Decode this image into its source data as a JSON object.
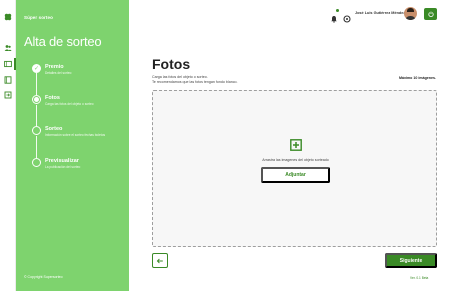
{
  "sidebar": {
    "brand": "Súper sorteo",
    "title": "Alta de sorteo",
    "copyright": "© Copyright Supersorteo",
    "steps": [
      {
        "label": "Premio",
        "desc": "Detalles del sorteo",
        "state": "done"
      },
      {
        "label": "Fotos",
        "desc": "Carga las fotos del objeto o sorteo",
        "state": "current"
      },
      {
        "label": "Sorteo",
        "desc": "Información sobre el sorteo fechas boletos",
        "state": "pending"
      },
      {
        "label": "Previsualizar",
        "desc": "La publicación del sorteo",
        "state": "pending"
      }
    ]
  },
  "header": {
    "username": "José Luis Gutiérrez Méndez"
  },
  "main": {
    "title": "Fotos",
    "instructions_line1": "Carga las fotos del objeto o sorteo.",
    "instructions_line2": "Te recomendamos que las fotos tengan fondo blanco.",
    "max_images": "Máximo 10 imágenes.",
    "dropzone_hint": "Arrastra las imagenes del objeto sorteado",
    "attach_label": "Adjuntar",
    "next_label": "Siguiente",
    "version": "Ver. 0.1 Beta"
  },
  "icons": {
    "logo": "clover-icon",
    "users": "users-icon",
    "tickets": "ticket-icon",
    "book": "book-icon",
    "login": "login-icon",
    "bell": "bell-icon",
    "settings": "gear-icon",
    "power": "power-icon",
    "add": "add-image-icon",
    "back": "arrow-left-icon"
  },
  "colors": {
    "sidebar": "#7ed36e",
    "primary": "#3a8a26"
  }
}
